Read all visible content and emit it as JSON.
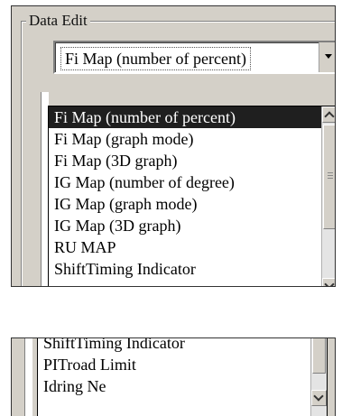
{
  "group": {
    "title": "Data Edit"
  },
  "combo": {
    "selected": "Fi Map (number of percent)",
    "button_icon": "chevron-down-icon"
  },
  "dropdown": {
    "items": [
      {
        "label": "Fi Map (number of percent)",
        "selected": true
      },
      {
        "label": "Fi Map (graph mode)"
      },
      {
        "label": "Fi Map (3D graph)"
      },
      {
        "label": "IG Map (number of degree)"
      },
      {
        "label": "IG Map (graph mode)"
      },
      {
        "label": "IG Map (3D graph)"
      },
      {
        "label": "RU MAP"
      },
      {
        "label": "ShiftTiming Indicator"
      }
    ],
    "scrollbar_icons": [
      "chevron-up-icon",
      "chevron-down-icon"
    ]
  },
  "dropdown_bottom": {
    "items": [
      {
        "label": "ShiftTiming Indicator"
      },
      {
        "label": "PITroad Limit"
      },
      {
        "label": "Idring Ne"
      }
    ]
  },
  "colors": {
    "window_bg": "#d4d0c8",
    "selection_bg": "#1f1f1f",
    "selection_fg": "#ffffff"
  }
}
